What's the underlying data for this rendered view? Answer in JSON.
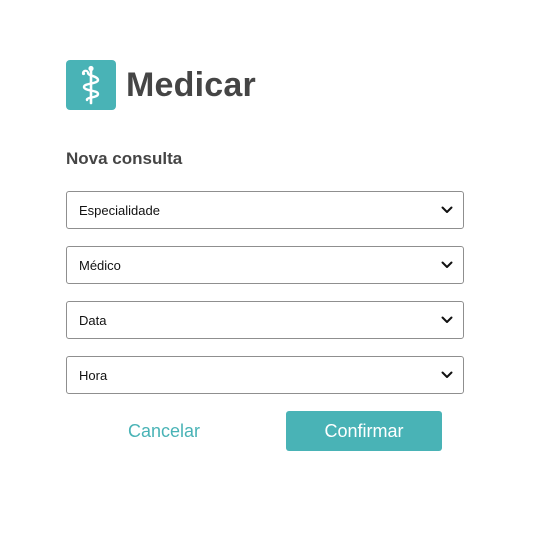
{
  "brand": {
    "name": "Medicar",
    "icon": "caduceus-icon",
    "accent_color": "#49b3b6",
    "text_color": "#454545"
  },
  "form": {
    "title": "Nova consulta",
    "selects": {
      "especialidade": "Especialidade",
      "medico": "Médico",
      "data": "Data",
      "hora": "Hora"
    },
    "cancel_label": "Cancelar",
    "confirm_label": "Confirmar"
  }
}
